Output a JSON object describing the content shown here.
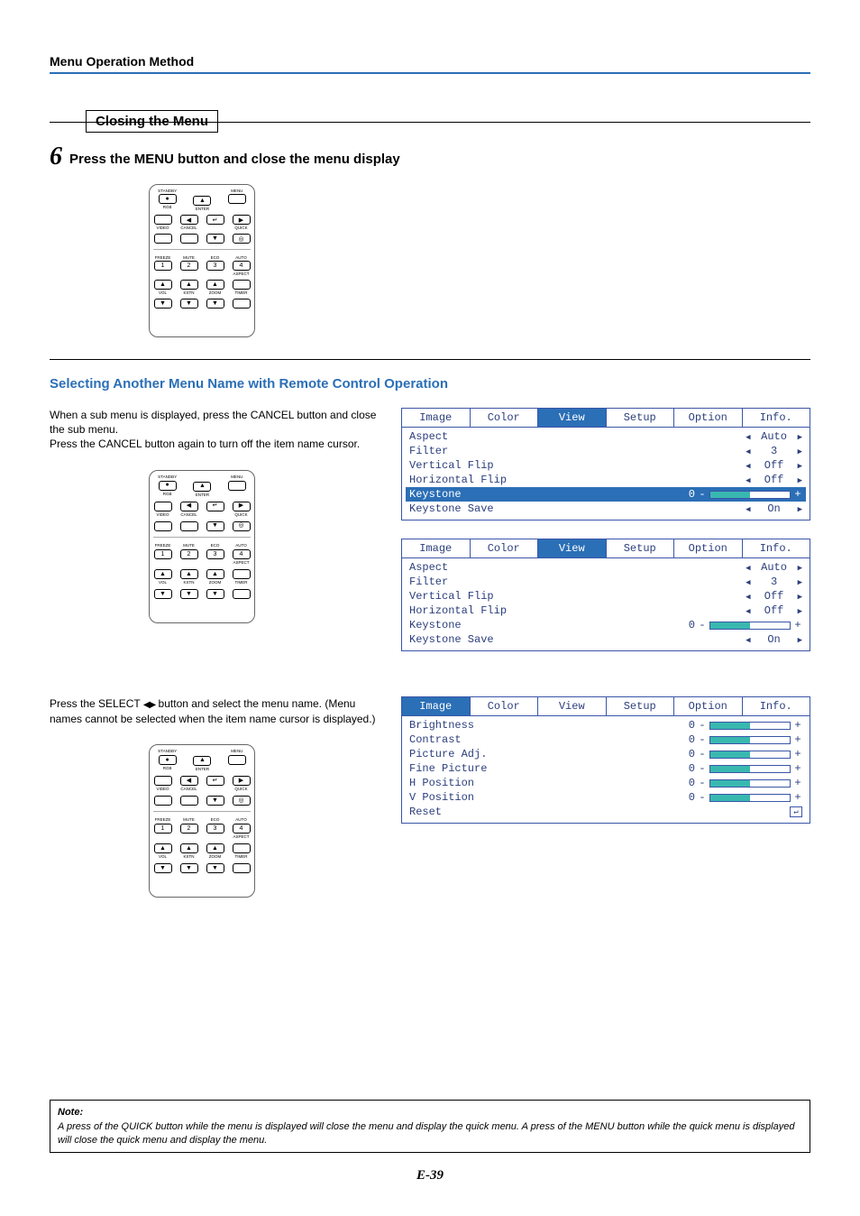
{
  "header": {
    "title": "Menu Operation Method"
  },
  "closing": {
    "box_title": "Closing the Menu",
    "step_num": "6",
    "step_text": "Press the MENU button and close the menu display"
  },
  "remote_labels": {
    "standby": "STANDBY",
    "menu": "MENU",
    "rgb": "RGB",
    "enter": "ENTER",
    "video": "VIDEO",
    "cancel": "CANCEL",
    "quick": "QUICK",
    "freeze": "FREEZE",
    "mute": "MUTE",
    "eco": "ECO",
    "auto": "AUTO",
    "aspect": "ASPECT",
    "vol": "VOL",
    "kstn": "KSTN",
    "zoom": "ZOOM",
    "timer": "TIMER",
    "b1": "1",
    "b2": "2",
    "b3": "3",
    "b4": "4"
  },
  "selecting": {
    "heading": "Selecting Another Menu Name with Remote Control Operation",
    "para1a": "When a sub menu is displayed, press the CANCEL button and close the sub menu.",
    "para1b": "Press the CANCEL button again to turn off the item name cursor.",
    "para2": "Press the SELECT ◀▶ button and select the menu name. (Menu names cannot be selected when the item name cursor is displayed.)"
  },
  "osd_tabs": [
    "Image",
    "Color",
    "View",
    "Setup",
    "Option",
    "Info."
  ],
  "view_menu": {
    "active_tab": "View",
    "rows": [
      {
        "name": "Aspect",
        "type": "lr",
        "val": "Auto"
      },
      {
        "name": "Filter",
        "type": "lr",
        "val": "3"
      },
      {
        "name": "Vertical Flip",
        "type": "lr",
        "val": "Off"
      },
      {
        "name": "Horizontal Flip",
        "type": "lr",
        "val": "Off"
      },
      {
        "name": "Keystone",
        "type": "slider",
        "num": "0",
        "selected": true
      },
      {
        "name": "Keystone Save",
        "type": "lr",
        "val": "On"
      }
    ]
  },
  "view_menu2": {
    "active_tab": "View",
    "rows": [
      {
        "name": "Aspect",
        "type": "lr",
        "val": "Auto"
      },
      {
        "name": "Filter",
        "type": "lr",
        "val": "3"
      },
      {
        "name": "Vertical Flip",
        "type": "lr",
        "val": "Off"
      },
      {
        "name": "Horizontal Flip",
        "type": "lr",
        "val": "Off"
      },
      {
        "name": "Keystone",
        "type": "slider",
        "num": "0"
      },
      {
        "name": "Keystone Save",
        "type": "lr",
        "val": "On"
      }
    ]
  },
  "image_menu": {
    "active_tab": "Image",
    "rows": [
      {
        "name": "Brightness",
        "type": "slider",
        "num": "0"
      },
      {
        "name": "Contrast",
        "type": "slider",
        "num": "0"
      },
      {
        "name": "Picture Adj.",
        "type": "slider",
        "num": "0"
      },
      {
        "name": "Fine Picture",
        "type": "slider",
        "num": "0"
      },
      {
        "name": "H Position",
        "type": "slider",
        "num": "0"
      },
      {
        "name": "V Position",
        "type": "slider",
        "num": "0"
      },
      {
        "name": "Reset",
        "type": "reset"
      }
    ]
  },
  "note": {
    "label": "Note:",
    "text": "A press of the QUICK button while the menu is displayed will close the menu and display the quick menu. A press of the MENU button while the quick menu is displayed will close the quick menu and display the menu."
  },
  "page_num": "E-39"
}
